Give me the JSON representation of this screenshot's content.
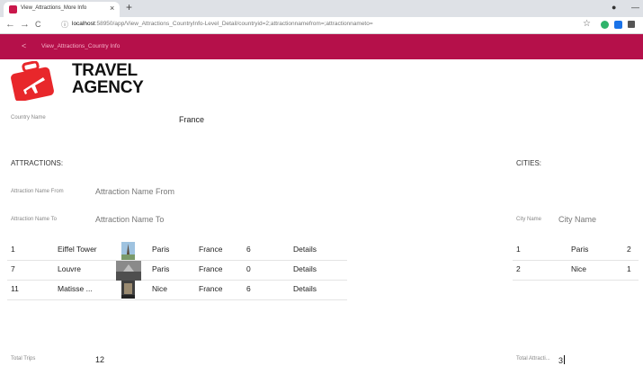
{
  "browser": {
    "tab_title": "View_Attractions_More Info",
    "tab_close": "×",
    "new_tab": "+",
    "url_host": "localhost",
    "url_rest": ":58950/app/View_Attractions_CountryInfo-Level_Detail/countryid=2;attractionnamefrom=;attractionnameto=",
    "nav_back": "←",
    "nav_forward": "→",
    "nav_reload": "C",
    "info": "ⓘ",
    "star": "☆",
    "win_min": "—",
    "win_dot": "●"
  },
  "header": {
    "back_icon": "<",
    "title": "View_Attractions_Country Info",
    "color": "#b5104a"
  },
  "logo": {
    "line1": "TRAVEL",
    "line2": "AGENCY",
    "suitcase_color": "#e8272b"
  },
  "country": {
    "label": "Country Name",
    "value": "France"
  },
  "attractions": {
    "section_title": "ATTRACTIONS:",
    "from_label": "Attraction Name From",
    "from_placeholder": "Attraction Name From",
    "to_label": "Attraction Name To",
    "to_placeholder": "Attraction Name To",
    "rows": [
      {
        "id": "1",
        "name": "Eiffel Tower",
        "city": "Paris",
        "country": "France",
        "trips": "6",
        "action": "Details"
      },
      {
        "id": "7",
        "name": "Louvre",
        "city": "Paris",
        "country": "France",
        "trips": "0",
        "action": "Details"
      },
      {
        "id": "11",
        "name": "Matisse ...",
        "city": "Nice",
        "country": "France",
        "trips": "6",
        "action": "Details"
      }
    ],
    "total_label": "Total Trips",
    "total_value": "12"
  },
  "cities": {
    "section_title": "CITIES:",
    "name_label": "City Name",
    "name_placeholder": "City Name",
    "rows": [
      {
        "id": "1",
        "name": "Paris",
        "count": "2"
      },
      {
        "id": "2",
        "name": "Nice",
        "count": "1"
      }
    ],
    "total_label": "Total Attracti...",
    "total_value": "3"
  }
}
